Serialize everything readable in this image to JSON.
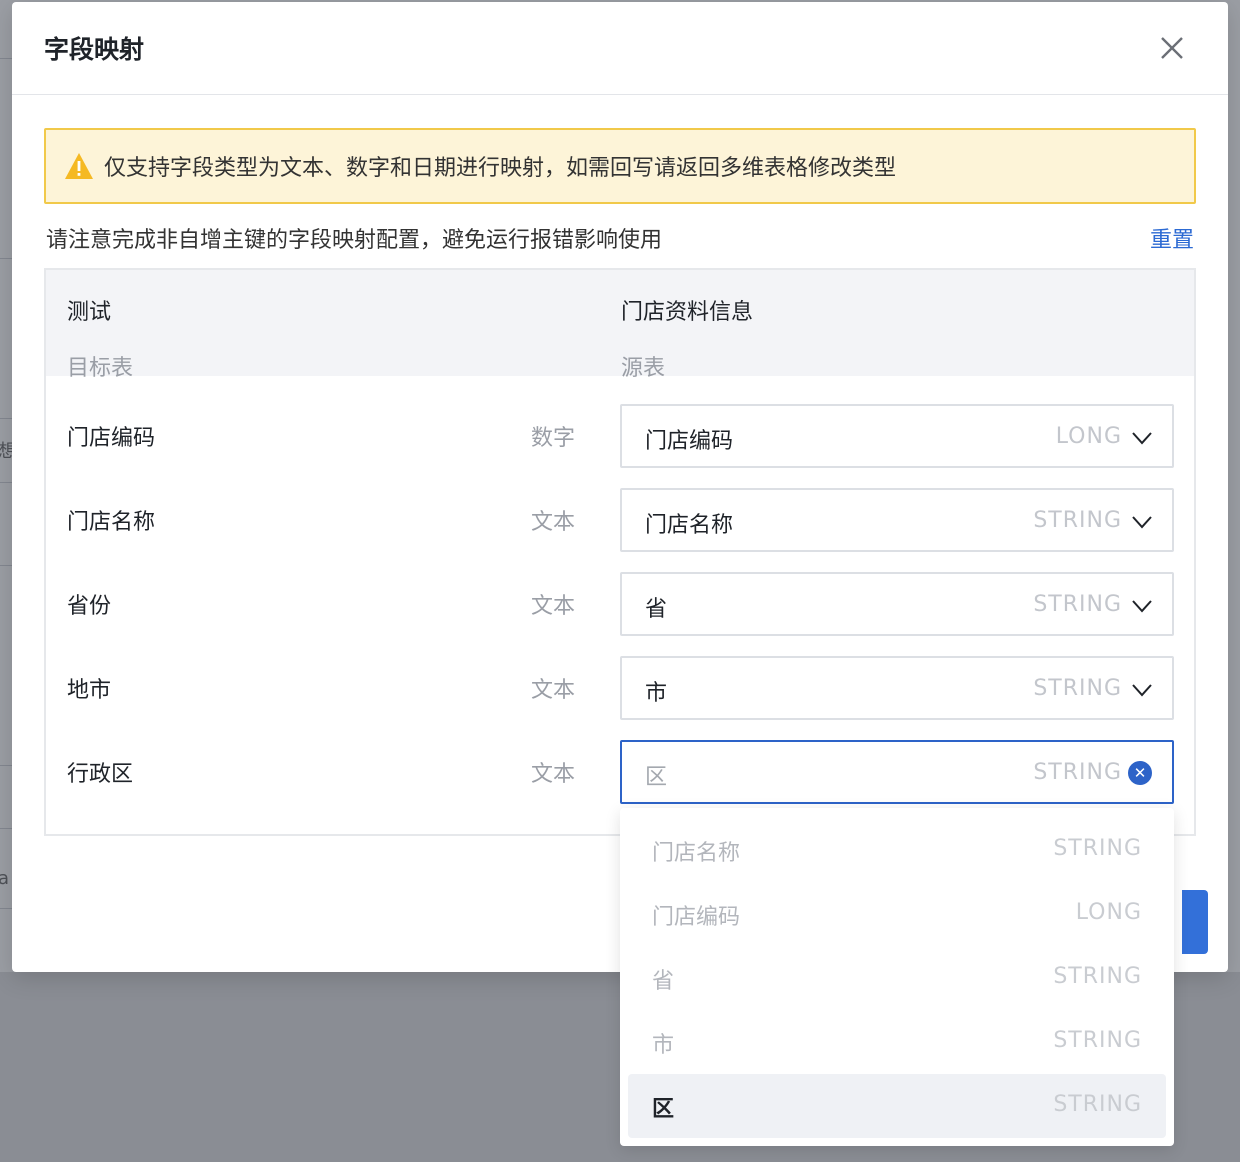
{
  "modal": {
    "title": "字段映射",
    "warning": "仅支持字段类型为文本、数字和日期进行映射，如需回写请返回多维表格修改类型",
    "note": "请注意完成非自增主键的字段映射配置，避免运行报错影响使用",
    "reset_label": "重置"
  },
  "table": {
    "left_title": "测试",
    "left_subtitle": "目标表",
    "right_title": "门店资料信息",
    "right_subtitle": "源表",
    "rows": [
      {
        "label": "门店编码",
        "type": "数字",
        "selected": "门店编码",
        "source_type": "LONG"
      },
      {
        "label": "门店名称",
        "type": "文本",
        "selected": "门店名称",
        "source_type": "STRING"
      },
      {
        "label": "省份",
        "type": "文本",
        "selected": "省",
        "source_type": "STRING"
      },
      {
        "label": "地市",
        "type": "文本",
        "selected": "市",
        "source_type": "STRING"
      },
      {
        "label": "行政区",
        "type": "文本",
        "selected": "区",
        "source_type": "STRING"
      }
    ]
  },
  "dropdown": {
    "options": [
      {
        "label": "门店名称",
        "type": "STRING"
      },
      {
        "label": "门店编码",
        "type": "LONG"
      },
      {
        "label": "省",
        "type": "STRING"
      },
      {
        "label": "市",
        "type": "STRING"
      },
      {
        "label": "区",
        "type": "STRING"
      }
    ]
  },
  "background": {
    "edge_text_1": "想",
    "edge_text_2": "a"
  },
  "colors": {
    "accent": "#2d63c8",
    "warning_bg": "#fdf4d8",
    "warning_border": "#f1c94a"
  }
}
